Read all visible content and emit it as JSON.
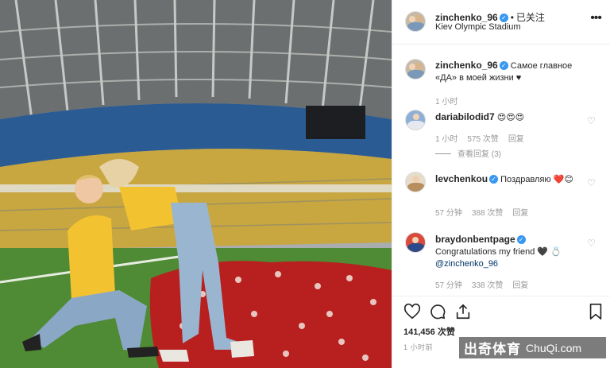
{
  "post": {
    "username": "zinchenko_96",
    "follow_state": "已关注",
    "location": "Kiev Olympic Stadium",
    "caption": "Самое главное «ДА» в моей жизни ♥",
    "caption_time": "1 小时",
    "likes": "141,456 次赞",
    "posted_ago": "1 小时前",
    "more_icon": "more-dots-icon"
  },
  "comments": [
    {
      "username": "dariabilodid7",
      "text": "😍😍😍",
      "time": "1 小时",
      "likes": "575 次赞",
      "reply": "回复",
      "view_replies": "查看回复 (3)"
    },
    {
      "username": "levchenkou",
      "text": "Поздравляю ❤️😊",
      "time": "57 分钟",
      "likes": "388 次赞",
      "reply": "回复"
    },
    {
      "username": "braydonbentpage",
      "text": "Congratulations my friend 🖤 💍",
      "mention": "@zinchenko_96",
      "time": "57 分钟",
      "likes": "338 次赞",
      "reply": "回复"
    }
  ],
  "actions": {
    "like_icon": "heart-icon",
    "comment_icon": "comment-icon",
    "share_icon": "share-icon",
    "save_icon": "bookmark-icon"
  },
  "watermark": {
    "cn": "出奇体育",
    "en": "ChuQi.com"
  }
}
